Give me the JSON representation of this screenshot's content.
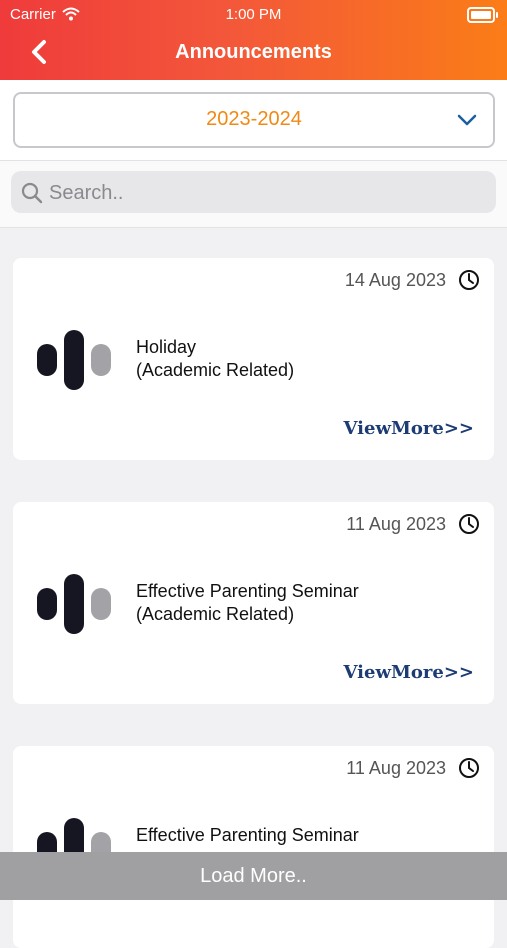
{
  "status_bar": {
    "carrier": "Carrier",
    "time": "1:00 PM"
  },
  "header": {
    "title": "Announcements",
    "back_icon": "chevron-left-icon"
  },
  "year_filter": {
    "selected": "2023-2024",
    "icon": "chevron-down-icon"
  },
  "search": {
    "placeholder": "Search..",
    "value": "",
    "icon": "search-icon"
  },
  "announcements": [
    {
      "date": "14 Aug 2023",
      "title": "Holiday",
      "category": "(Academic Related)",
      "action": "ViewMore>>"
    },
    {
      "date": "11 Aug 2023",
      "title": "Effective Parenting Seminar",
      "category": "(Academic Related)",
      "action": "ViewMore>>"
    },
    {
      "date": "11 Aug 2023",
      "title": "Effective Parenting Seminar",
      "category": "",
      "action": ""
    }
  ],
  "footer": {
    "load_more": "Load More.."
  },
  "colors": {
    "accent": "#ef8a15",
    "header_start": "#ef3b3b",
    "header_end": "#fb7d17",
    "link": "#1c3c73"
  }
}
